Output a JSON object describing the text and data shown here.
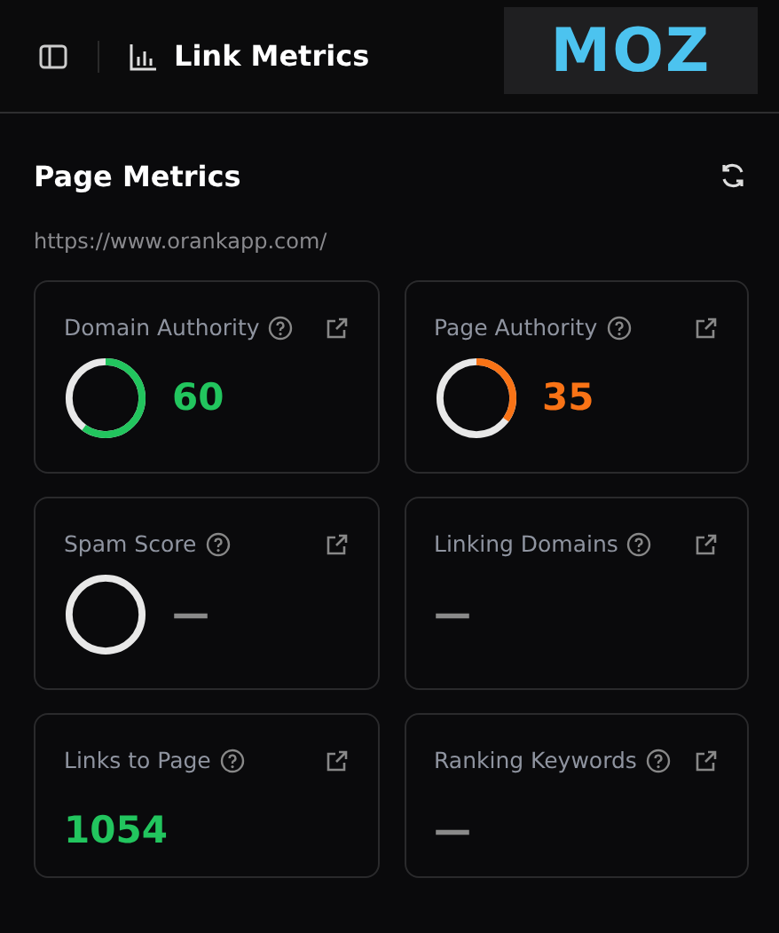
{
  "header": {
    "title": "Link Metrics",
    "logo": "MOZ"
  },
  "section": {
    "title": "Page Metrics",
    "url": "https://www.orankapp.com/"
  },
  "metrics": [
    {
      "label": "Domain Authority",
      "kind": "gauge",
      "level": 0.6,
      "value": "60",
      "color": "#22c55e"
    },
    {
      "label": "Page Authority",
      "kind": "gauge",
      "level": 0.35,
      "value": "35",
      "color": "#f97316"
    },
    {
      "label": "Spam Score",
      "kind": "gauge",
      "level": 0,
      "value": "—",
      "color": "#8a8a8a"
    },
    {
      "label": "Linking Domains",
      "kind": "plain",
      "value": "—",
      "color": "#8a8a8a"
    },
    {
      "label": "Links to Page",
      "kind": "plain",
      "value": "1054",
      "color": "#22c55e"
    },
    {
      "label": "Ranking Keywords",
      "kind": "plain",
      "value": "—",
      "color": "#8a8a8a"
    }
  ]
}
